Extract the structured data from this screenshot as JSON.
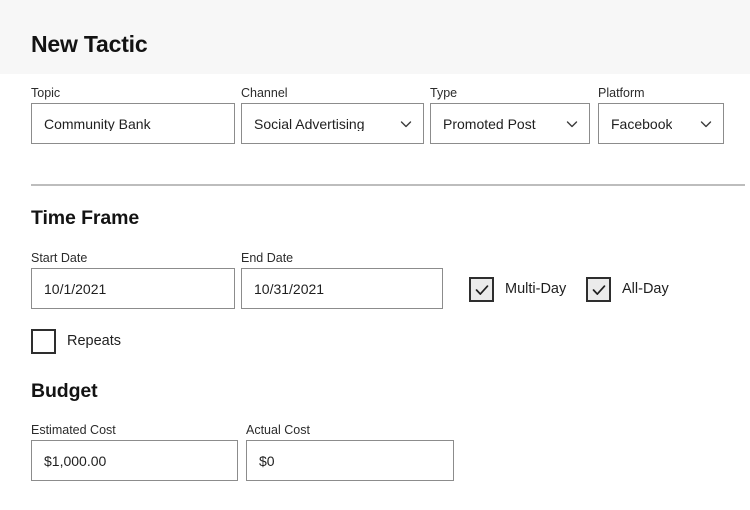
{
  "header": {
    "title": "New Tactic"
  },
  "top_fields": [
    {
      "label": "Topic",
      "value": "Community Bank",
      "control": "text",
      "name": "topic"
    },
    {
      "label": "Channel",
      "value": "Social Advertising",
      "control": "select",
      "name": "channel",
      "icon": "chevron-down-icon"
    },
    {
      "label": "Type",
      "value": "Promoted Post",
      "control": "select",
      "name": "type",
      "icon": "chevron-down-icon"
    },
    {
      "label": "Platform",
      "value": "Facebook",
      "control": "select",
      "name": "platform",
      "icon": "chevron-down-icon"
    }
  ],
  "time_frame": {
    "heading": "Time Frame",
    "start_date": {
      "label": "Start Date",
      "value": "10/1/2021"
    },
    "end_date": {
      "label": "End Date",
      "value": "10/31/2021"
    },
    "multi_day": {
      "label": "Multi-Day",
      "checked": true,
      "icon": "check-icon"
    },
    "all_day": {
      "label": "All-Day",
      "checked": true,
      "icon": "check-icon"
    },
    "repeats": {
      "label": "Repeats",
      "checked": false
    }
  },
  "budget": {
    "heading": "Budget",
    "estimated_cost": {
      "label": "Estimated Cost",
      "value": "$1,000.00"
    },
    "actual_cost": {
      "label": "Actual Cost",
      "value": "$0"
    }
  },
  "colors": {
    "header_background": "#f7f7f7",
    "page_background": "#ffffff",
    "input_border": "#8c8c8c",
    "divider": "#bdbdbd",
    "checkbox_border": "#2e2e2e",
    "checkbox_fill_checked": "#ebebeb",
    "text": "#1c1c1c"
  }
}
